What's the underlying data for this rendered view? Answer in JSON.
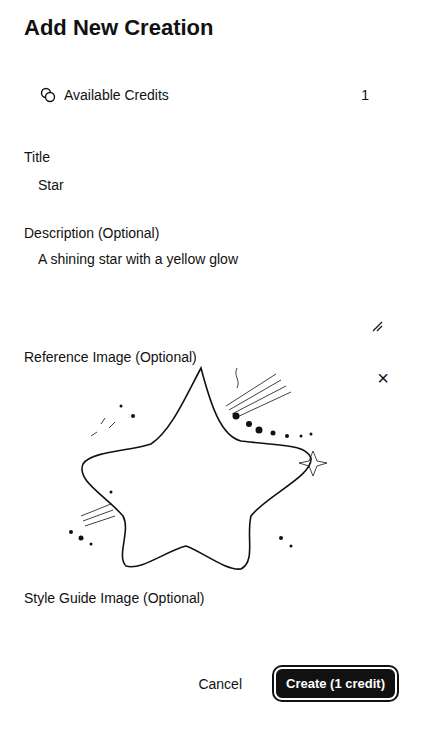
{
  "header": {
    "title": "Add New Creation"
  },
  "credits": {
    "label": "Available Credits",
    "value": "1"
  },
  "fields": {
    "title": {
      "label": "Title",
      "value": "Star"
    },
    "description": {
      "label": "Description (Optional)",
      "value": "A shining star with a yellow glow"
    }
  },
  "reference_image": {
    "label": "Reference Image (Optional)",
    "remove_glyph": "×"
  },
  "style_guide_image": {
    "label": "Style Guide Image (Optional)"
  },
  "buttons": {
    "cancel": "Cancel",
    "create": "Create (1 credit)"
  }
}
